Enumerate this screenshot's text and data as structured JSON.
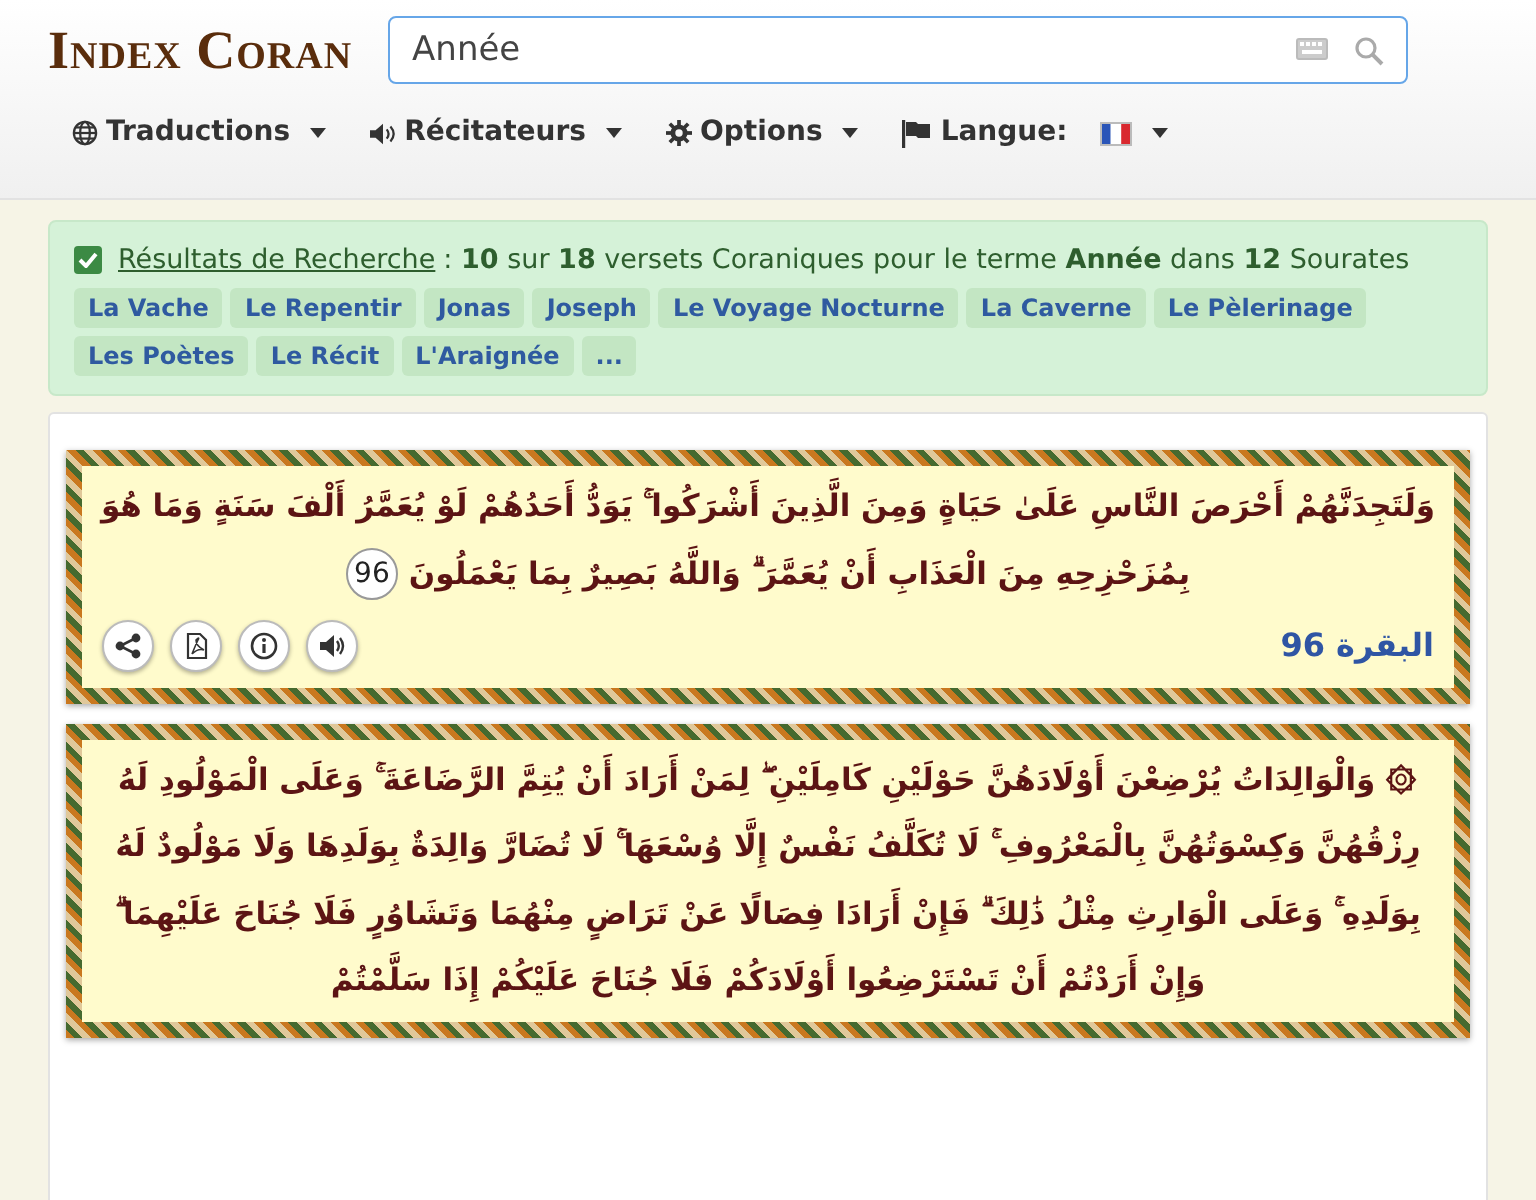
{
  "logo": {
    "first": "Index",
    "second": "Coran"
  },
  "search": {
    "value": "Année"
  },
  "menu": [
    {
      "label": "Traductions"
    },
    {
      "label": "Récitateurs"
    },
    {
      "label": "Options"
    },
    {
      "label": "Langue:"
    }
  ],
  "results": {
    "checked": true,
    "link": "Résultats de Recherche",
    "summary": ": **10** sur **18** versets Coraniques pour le terme **Année** dans **12** Sourates",
    "suras": [
      "La Vache",
      "Le Repentir",
      "Jonas",
      "Joseph",
      "Le Voyage Nocturne",
      "La Caverne",
      "Le Pèlerinage",
      "Les Poètes",
      "Le Récit",
      "L'Araignée",
      "..."
    ]
  },
  "verses": [
    {
      "text": "وَلَتَجِدَنَّهُمْ أَحْرَصَ النَّاسِ عَلَىٰ حَيَاةٍ وَمِنَ الَّذِينَ أَشْرَكُوا ۚ يَوَدُّ أَحَدُهُمْ لَوْ يُعَمَّرُ أَلْفَ سَنَةٍ وَمَا هُوَ بِمُزَحْزِحِهِ مِنَ الْعَذَابِ أَنْ يُعَمَّرَ ۗ وَاللَّهُ بَصِيرٌ بِمَا يَعْمَلُونَ",
      "number": "96",
      "reference": "البقرة 96"
    },
    {
      "text": "۞ وَالْوَالِدَاتُ يُرْضِعْنَ أَوْلَادَهُنَّ حَوْلَيْنِ كَامِلَيْنِ ۖ لِمَنْ أَرَادَ أَنْ يُتِمَّ الرَّضَاعَةَ ۚ وَعَلَى الْمَوْلُودِ لَهُ رِزْقُهُنَّ وَكِسْوَتُهُنَّ بِالْمَعْرُوفِ ۚ لَا تُكَلَّفُ نَفْسٌ إِلَّا وُسْعَهَا ۚ لَا تُضَارَّ وَالِدَةٌ بِوَلَدِهَا وَلَا مَوْلُودٌ لَهُ بِوَلَدِهِ ۚ وَعَلَى الْوَارِثِ مِثْلُ ذَٰلِكَ ۗ فَإِنْ أَرَادَا فِصَالًا عَنْ تَرَاضٍ مِنْهُمَا وَتَشَاوُرٍ فَلَا جُنَاحَ عَلَيْهِمَا ۗ وَإِنْ أَرَدْتُمْ أَنْ تَسْتَرْضِعُوا أَوْلَادَكُمْ فَلَا جُنَاحَ عَلَيْكُمْ إِذَا سَلَّمْتُمْ"
    }
  ]
}
